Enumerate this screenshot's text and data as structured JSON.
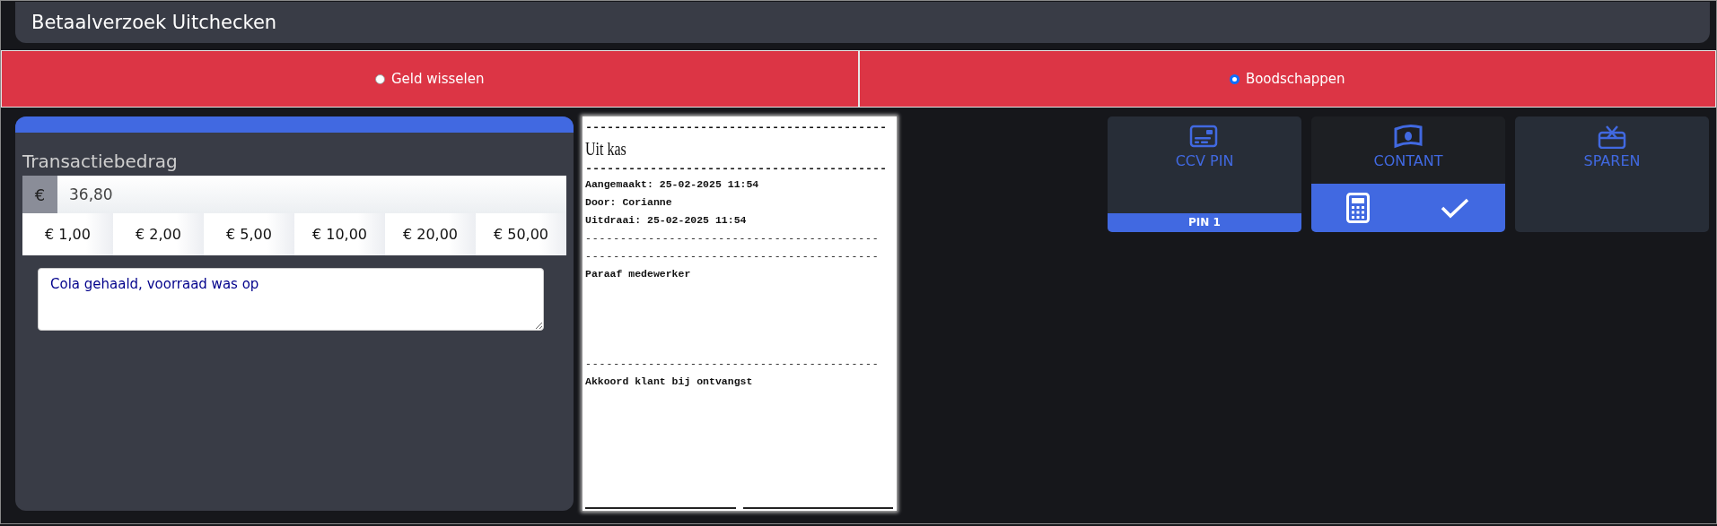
{
  "header": {
    "title": "Betaalverzoek Uitchecken"
  },
  "tabs": [
    {
      "label": "Geld wisselen",
      "selected": false
    },
    {
      "label": "Boodschappen",
      "selected": true
    }
  ],
  "amount_panel": {
    "label": "Transactiebedrag",
    "currency": "€",
    "value": "36,80",
    "quick_amounts": [
      "€ 1,00",
      "€ 2,00",
      "€ 5,00",
      "€ 10,00",
      "€ 20,00",
      "€ 50,00"
    ],
    "note": "Cola gehaald, voorraad was op"
  },
  "receipt": {
    "lines": [
      {
        "kind": "heavy",
        "text": "------------------------------------------"
      },
      {
        "kind": "title",
        "text": "Uit kas"
      },
      {
        "kind": "heavy",
        "text": "------------------------------------------"
      },
      {
        "kind": "text",
        "text": "Aangemaakt: 25-02-2025 11:54"
      },
      {
        "kind": "text",
        "text": "Door: Corianne"
      },
      {
        "kind": "text",
        "text": "Uitdraai: 25-02-2025 11:54"
      },
      {
        "kind": "rule",
        "text": "------------------------------------------"
      },
      {
        "kind": "rule",
        "text": "------------------------------------------"
      },
      {
        "kind": "text",
        "text": "Paraaf medewerker"
      },
      {
        "kind": "blank"
      },
      {
        "kind": "blank"
      },
      {
        "kind": "blank"
      },
      {
        "kind": "blank"
      },
      {
        "kind": "rule",
        "text": "------------------------------------------"
      },
      {
        "kind": "text",
        "text": "Akkoord klant bij ontvangst"
      }
    ]
  },
  "payment_methods": [
    {
      "label": "CCV PIN",
      "kind": "card",
      "selected": false,
      "badge": "PIN 1"
    },
    {
      "label": "CONTANT",
      "kind": "cash",
      "selected": true
    },
    {
      "label": "SPAREN",
      "kind": "gift",
      "selected": false
    }
  ]
}
